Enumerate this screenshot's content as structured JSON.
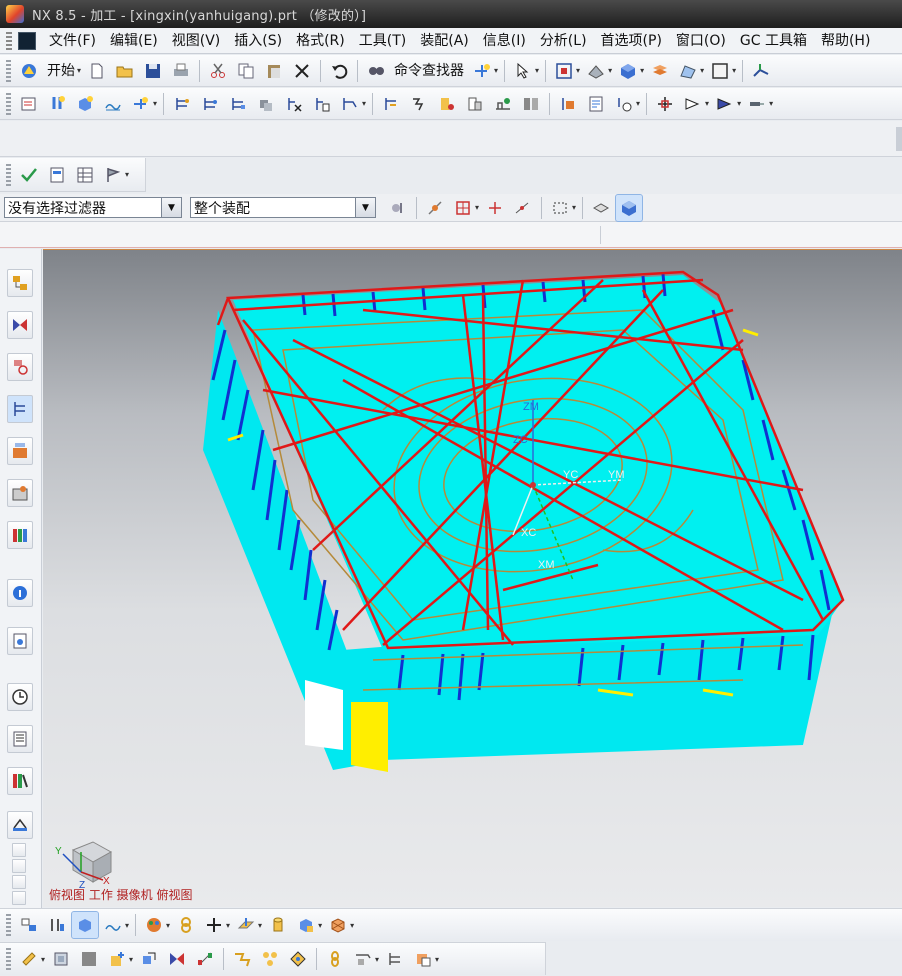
{
  "window": {
    "title": "NX 8.5 - 加工 - [xingxin(yanhuigang).prt （修改的）]"
  },
  "menu": {
    "items": [
      {
        "label": "文件(F)"
      },
      {
        "label": "编辑(E)"
      },
      {
        "label": "视图(V)"
      },
      {
        "label": "插入(S)"
      },
      {
        "label": "格式(R)"
      },
      {
        "label": "工具(T)"
      },
      {
        "label": "装配(A)"
      },
      {
        "label": "信息(I)"
      },
      {
        "label": "分析(L)"
      },
      {
        "label": "首选项(P)"
      },
      {
        "label": "窗口(O)"
      },
      {
        "label": "GC 工具箱"
      },
      {
        "label": "帮助(H)"
      }
    ]
  },
  "toolbar": {
    "start_label": "开始",
    "command_finder_label": "命令查找器"
  },
  "filters": {
    "selection_filter": "没有选择过滤器",
    "assembly_scope": "整个装配"
  },
  "viewport": {
    "view_label": "俯视图 工作 摄像机 俯视图",
    "axis_labels": {
      "zm": "ZM",
      "zc": "ZC",
      "yc": "YC",
      "ym": "YM",
      "xc": "XC",
      "xm": "XM",
      "triad_y": "Y",
      "triad_z": "Z",
      "triad_x": "X"
    },
    "colors": {
      "part_face": "#00f0f0",
      "wire_red": "#e01818",
      "wire_gold": "#b58a3a",
      "edge_blue": "#1030d0",
      "highlight_yellow": "#ffee00"
    }
  },
  "icons": {
    "toolbar1": [
      "start-icon",
      "new-icon",
      "open-icon",
      "save-icon",
      "print-icon",
      "cut-icon",
      "copy-icon",
      "paste-icon",
      "delete-icon",
      "undo-icon",
      "command-finder-icon",
      "touch-mode-icon",
      "selection-icon",
      "fit-view-icon",
      "render-style-icon",
      "orient-view-icon",
      "layer-icon",
      "snap-view-icon",
      "background-icon",
      "wcs-icon"
    ],
    "resource_bar": [
      "assembly-navigator-icon",
      "constraint-navigator-icon",
      "part-navigator-icon",
      "operation-navigator-icon",
      "machine-tool-icon",
      "reuse-library-icon",
      "hd3d-tools-icon",
      "web-browser-icon",
      "history-icon",
      "system-materials-icon",
      "roles-icon",
      "process-studio-icon"
    ]
  }
}
